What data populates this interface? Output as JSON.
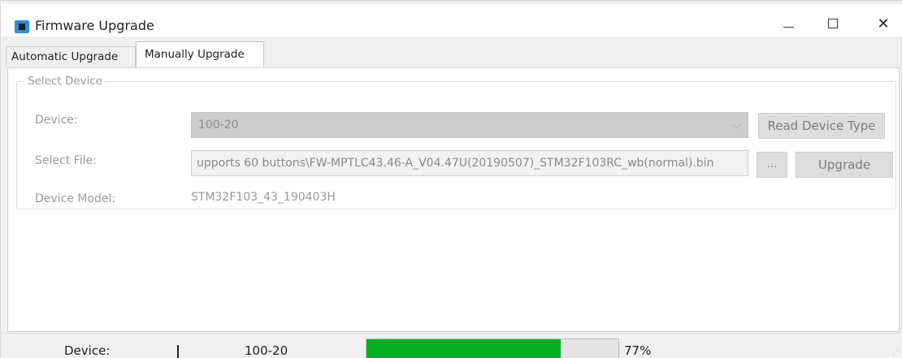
{
  "window": {
    "title": "Firmware Upgrade"
  },
  "tabs": [
    {
      "label": "Automatic Upgrade"
    },
    {
      "label": "Manually Upgrade"
    }
  ],
  "select_device": {
    "legend": "Select Device",
    "device_label": "Device:",
    "device_value": "100-20",
    "read_device_type_label": "Read Device Type",
    "file_label": "Select File:",
    "file_value": "upports 60 buttons\\FW-MPTLC43.46-A_V04.47U(20190507)_STM32F103RC_wb(normal).bin",
    "browse_label": "...",
    "upgrade_label": "Upgrade",
    "model_label": "Device Model:",
    "model_value": "STM32F103_43_190403H"
  },
  "statusbar": {
    "device_label": "Device:",
    "device_value": "100-20",
    "progress_text": "77%",
    "progress_fraction": 0.77
  },
  "colors": {
    "progress_fill": "#06b025",
    "icon_accent": "#2f8fd6"
  }
}
